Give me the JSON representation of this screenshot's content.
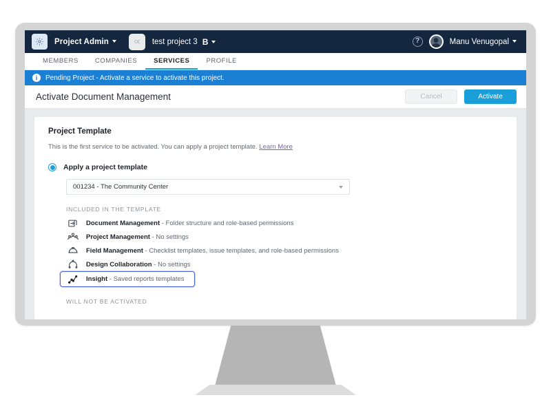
{
  "header": {
    "gear_icon": "gear-icon",
    "app_title": "Project Admin",
    "project_thumb_icon": "project-thumbnail-icon",
    "project_name": "test project 3",
    "project_code": "B",
    "help_icon": "?",
    "user_name": "Manu Venugopal"
  },
  "tabs": [
    {
      "label": "MEMBERS",
      "active": false
    },
    {
      "label": "COMPANIES",
      "active": false
    },
    {
      "label": "SERVICES",
      "active": true
    },
    {
      "label": "PROFILE",
      "active": false
    }
  ],
  "banner": {
    "icon": "i",
    "text": "Pending Project - Activate a service to activate this project."
  },
  "page": {
    "title": "Activate Document Management",
    "cancel_label": "Cancel",
    "activate_label": "Activate"
  },
  "card": {
    "title": "Project Template",
    "description": "This is the first service to be activated. You can apply a project template.",
    "learn_more": "Learn More",
    "radio_label": "Apply a project template",
    "selected_template": "001234 - The Community Center",
    "included_label": "INCLUDED IN THE TEMPLATE",
    "not_activated_label": "WILL NOT BE ACTIVATED",
    "included_services": [
      {
        "icon": "document-management-icon",
        "name": "Document Management",
        "detail": " - Folder structure and role-based permissions"
      },
      {
        "icon": "project-management-icon",
        "name": "Project Management",
        "detail": " - No settings"
      },
      {
        "icon": "field-management-icon",
        "name": "Field Management",
        "detail": " - Checklist templates, issue templates, and role-based permissions"
      },
      {
        "icon": "design-collaboration-icon",
        "name": "Design Collaboration",
        "detail": " - No settings"
      },
      {
        "icon": "insight-icon",
        "name": "Insight",
        "detail": " - Saved reports templates"
      }
    ]
  },
  "colors": {
    "header_bg": "#15263f",
    "banner_blue": "#1b7fd4",
    "accent_blue": "#1b9fdb",
    "focus_indigo": "#4b62d6",
    "link_purple": "#7c5fb3",
    "bezel_gray": "#d4d4d4",
    "stand_gray": "#b5b5b5"
  }
}
